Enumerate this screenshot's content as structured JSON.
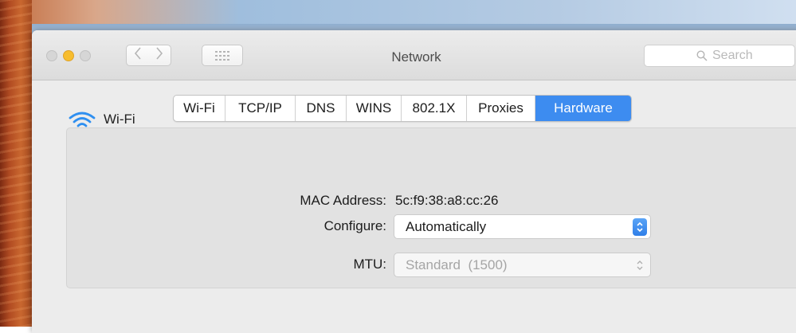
{
  "window": {
    "title": "Network",
    "search_placeholder": "Search"
  },
  "interface": {
    "name": "Wi-Fi"
  },
  "tabs": [
    {
      "label": "Wi-Fi",
      "active": false
    },
    {
      "label": "TCP/IP",
      "active": false
    },
    {
      "label": "DNS",
      "active": false
    },
    {
      "label": "WINS",
      "active": false
    },
    {
      "label": "802.1X",
      "active": false
    },
    {
      "label": "Proxies",
      "active": false
    },
    {
      "label": "Hardware",
      "active": true
    }
  ],
  "hardware": {
    "mac_label": "MAC Address:",
    "mac_value": "5c:f9:38:a8:cc:26",
    "configure_label": "Configure:",
    "configure_value": "Automatically",
    "mtu_label": "MTU:",
    "mtu_value": "Standard  (1500)"
  },
  "icons": {
    "wifi": "wifi-icon",
    "search": "search-icon",
    "back": "chevron-left-icon",
    "forward": "chevron-right-icon",
    "grid": "grid-icon",
    "stepper": "up-down-arrows-icon"
  },
  "colors": {
    "accent": "#3d8cf0",
    "wifi_icon": "#2f8ff0",
    "minimize_button": "#f7bd2e"
  }
}
